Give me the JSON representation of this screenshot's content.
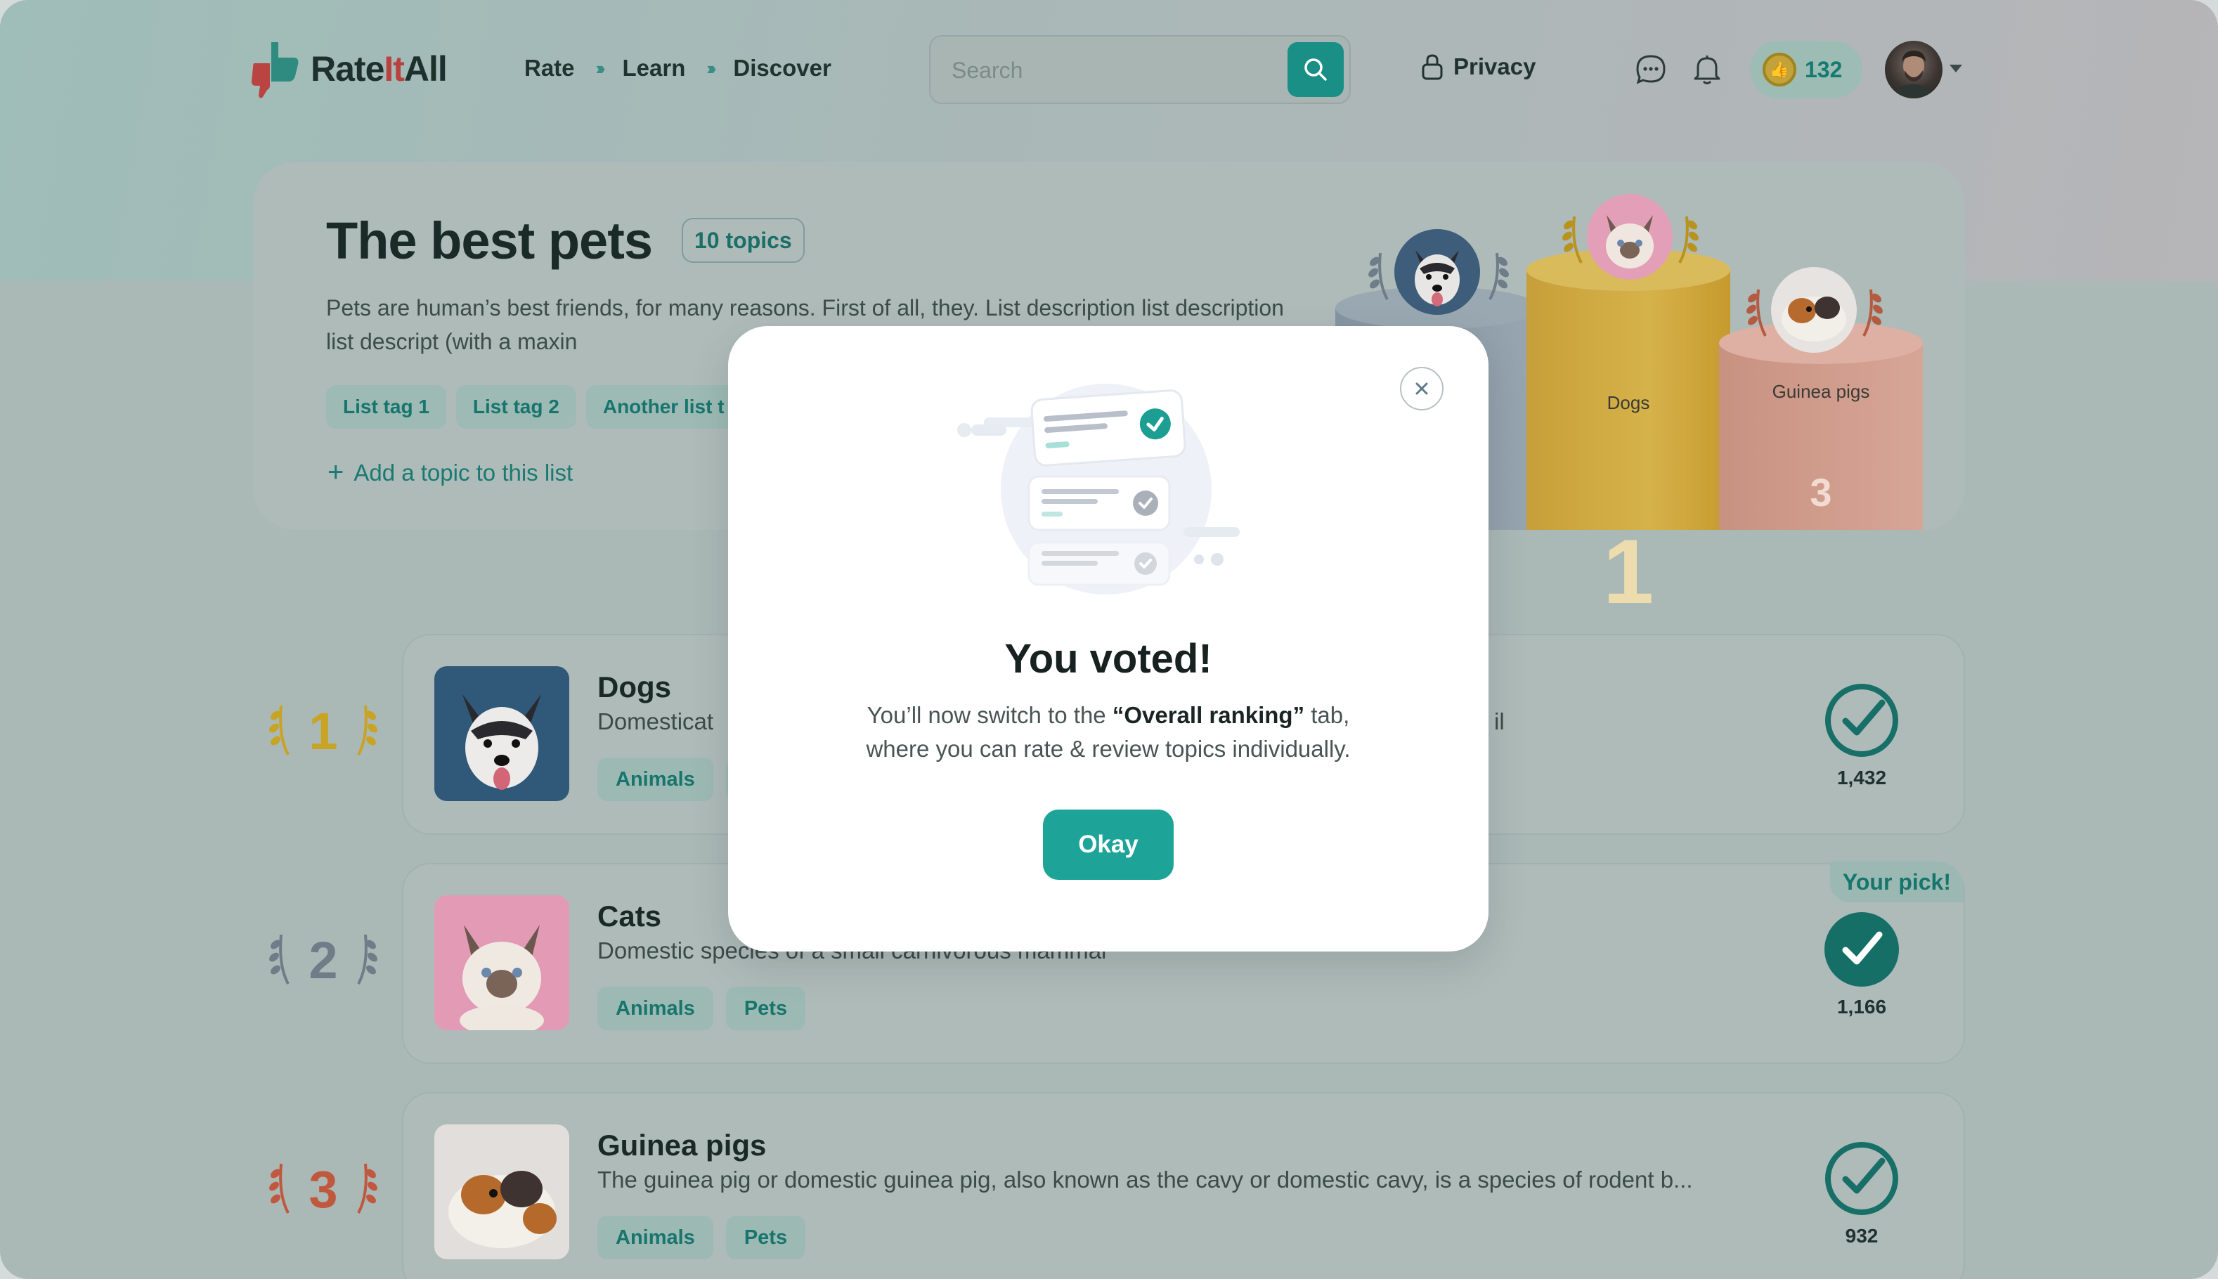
{
  "header": {
    "logo_text_1": "Rate",
    "logo_text_2": "It",
    "logo_text_3": "All",
    "nav": [
      "Rate",
      "Learn",
      "Discover"
    ],
    "nav_separator": "›››",
    "search_placeholder": "Search",
    "privacy_label": "Privacy",
    "coins": "132"
  },
  "list": {
    "title": "The best pets",
    "topics_badge": "10 topics",
    "description": "Pets are human’s best friends, for many reasons. First of all, they. List description list description list descript (with a maxin",
    "tags": [
      "List tag 1",
      "List tag  2",
      "Another list t"
    ],
    "add_topic": "Add a topic to this list"
  },
  "podium": {
    "first_label": "Dogs",
    "first_num": "1",
    "third_label": "Guinea pigs",
    "third_num": "3"
  },
  "rankings": [
    {
      "rank": "1",
      "title": "Dogs",
      "description": "Domesticat",
      "desc_tail": "il",
      "tags": [
        "Animals",
        ""
      ],
      "votes": "1,432",
      "pick": ""
    },
    {
      "rank": "2",
      "title": "Cats",
      "description": "Domestic species of a small carnivorous mammal",
      "desc_tail": "",
      "tags": [
        "Animals",
        "Pets"
      ],
      "votes": "1,166",
      "pick": "Your pick!"
    },
    {
      "rank": "3",
      "title": "Guinea pigs",
      "description": "The guinea pig or domestic guinea pig, also known as the cavy or domestic cavy, is a species of rodent b...",
      "desc_tail": "",
      "tags": [
        "Animals",
        "Pets"
      ],
      "votes": "932",
      "pick": ""
    }
  ],
  "modal": {
    "title": "You voted!",
    "text_1": "You’ll now switch to the ",
    "text_bold": "“Overall ranking”",
    "text_2": " tab,",
    "text_3": "where you can rate & review topics individually.",
    "ok_label": "Okay"
  },
  "colors": {
    "accent": "#1da398",
    "gold": "#c9a33a",
    "silver": "#7f8d96",
    "bronze": "#c0654d"
  }
}
